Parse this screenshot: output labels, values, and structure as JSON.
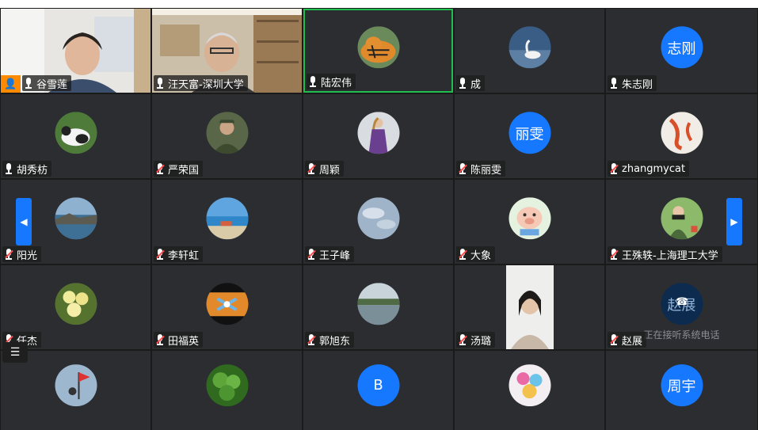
{
  "participants": [
    {
      "name": "谷雪莲",
      "muted": false,
      "type": "video"
    },
    {
      "name": "汪天富-深圳大学",
      "muted": false,
      "type": "video"
    },
    {
      "name": "陆宏伟",
      "muted": false,
      "type": "photo",
      "icon": "tiger-icon"
    },
    {
      "name": "成",
      "muted": false,
      "type": "photo",
      "icon": "swan-icon"
    },
    {
      "name": "朱志刚",
      "muted": false,
      "type": "text",
      "avatar_text": "志刚"
    },
    {
      "name": "胡秀枋",
      "muted": false,
      "type": "photo",
      "icon": "panda-icon"
    },
    {
      "name": "严荣国",
      "muted": true,
      "type": "photo",
      "icon": "portrait-icon"
    },
    {
      "name": "周颖",
      "muted": true,
      "type": "photo",
      "icon": "figure-icon"
    },
    {
      "name": "陈丽雯",
      "muted": true,
      "type": "text",
      "avatar_text": "丽雯"
    },
    {
      "name": "zhangmycat",
      "muted": true,
      "type": "photo",
      "icon": "koi-icon"
    },
    {
      "name": "阳光",
      "muted": true,
      "type": "photo",
      "icon": "coast-icon"
    },
    {
      "name": "李轩虹",
      "muted": true,
      "type": "photo",
      "icon": "beach-icon"
    },
    {
      "name": "王子峰",
      "muted": true,
      "type": "photo",
      "icon": "sky-icon"
    },
    {
      "name": "大象",
      "muted": true,
      "type": "photo",
      "icon": "pig-cartoon-icon"
    },
    {
      "name": "王殊轶-上海理工大学",
      "muted": true,
      "type": "photo",
      "icon": "camera-person-icon"
    },
    {
      "name": "任杰",
      "muted": true,
      "type": "photo",
      "icon": "flower-icon"
    },
    {
      "name": "田福英",
      "muted": true,
      "type": "photo",
      "icon": "craft-icon"
    },
    {
      "name": "郭旭东",
      "muted": true,
      "type": "photo",
      "icon": "lake-icon"
    },
    {
      "name": "汤璐",
      "muted": true,
      "type": "video"
    },
    {
      "name": "赵展",
      "muted": true,
      "type": "phone",
      "avatar_text": "赵展",
      "status": "正在接听系统电话"
    },
    {
      "name": "",
      "muted": false,
      "type": "photo",
      "icon": "flag-icon"
    },
    {
      "name": "",
      "muted": false,
      "type": "photo",
      "icon": "leaf-icon"
    },
    {
      "name": "",
      "muted": false,
      "type": "text",
      "avatar_text": "B"
    },
    {
      "name": "",
      "muted": false,
      "type": "photo",
      "icon": "candy-icon"
    },
    {
      "name": "",
      "muted": false,
      "type": "text",
      "avatar_text": "周宇"
    }
  ],
  "pager": {
    "prev": "◀",
    "next": "▶"
  },
  "list_button": "☰",
  "colors": {
    "accent": "#1677ff",
    "active_border": "#1fbf4f",
    "tile_bg": "#2b2d31",
    "host_badge": "#ff8a00",
    "muted": "#ff4d4f"
  }
}
